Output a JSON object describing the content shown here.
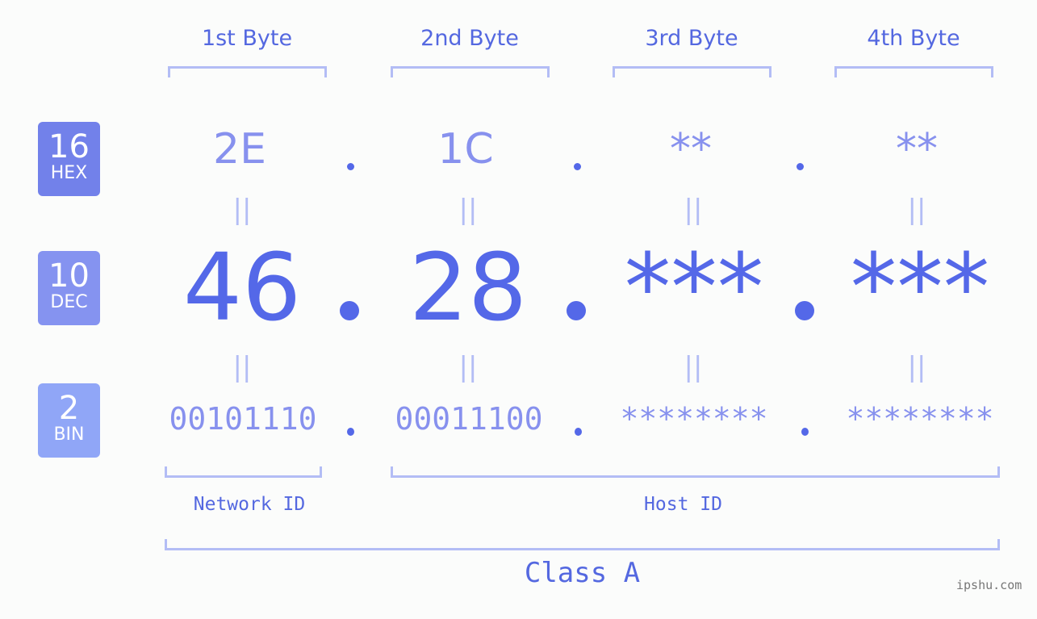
{
  "byte_headers": [
    "1st Byte",
    "2nd Byte",
    "3rd Byte",
    "4th Byte"
  ],
  "badges": [
    {
      "number": "16",
      "label": "HEX",
      "color": "#7281ea"
    },
    {
      "number": "10",
      "label": "DEC",
      "color": "#8593f0"
    },
    {
      "number": "2",
      "label": "BIN",
      "color": "#90a6f7"
    }
  ],
  "hex": [
    "2E",
    "1C",
    "**",
    "**"
  ],
  "dec": [
    "46",
    "28",
    "***",
    "***"
  ],
  "bin": [
    "00101110",
    "00011100",
    "********",
    "********"
  ],
  "equals_glyph": "||",
  "network_id_label": "Network ID",
  "host_id_label": "Host ID",
  "class_label": "Class A",
  "watermark": "ipshu.com",
  "colors": {
    "primary": "#5468e8",
    "light": "#8791ee",
    "bracket": "#b3bdf5"
  }
}
